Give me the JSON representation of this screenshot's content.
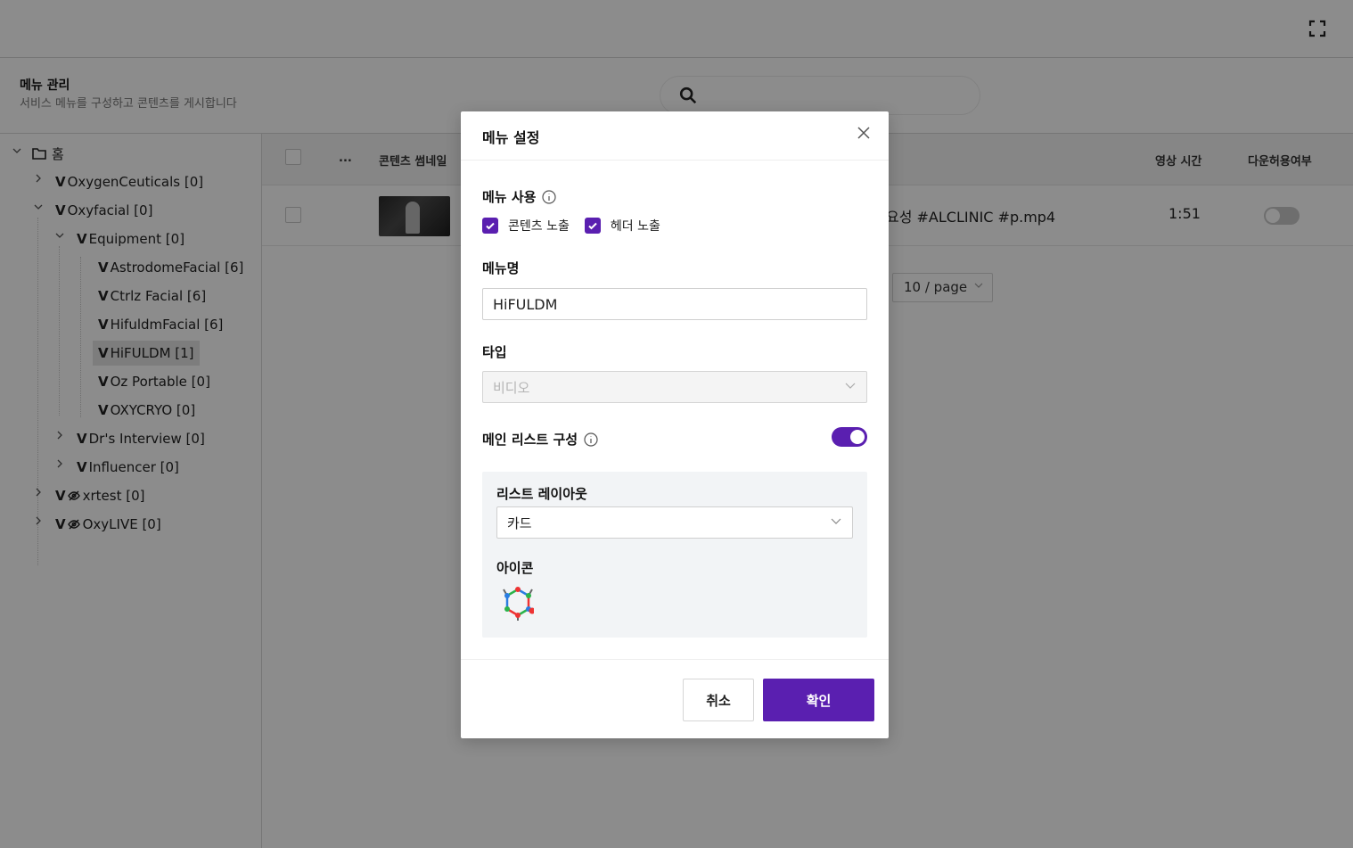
{
  "header": {
    "fullscreen_icon": "expand-icon"
  },
  "page": {
    "title": "메뉴 관리",
    "description": "서비스 메뉴를 구성하고 콘텐츠를 게시합니다",
    "search": {
      "value": "",
      "placeholder": ""
    }
  },
  "tree": {
    "root": "홈",
    "items": [
      {
        "label": "OxygenCeuticals [0]",
        "expanded": false
      },
      {
        "label": "Oxyfacial [0]",
        "expanded": true
      },
      {
        "label": "Equipment [0]",
        "expanded": true
      },
      {
        "label": "AstrodomeFacial [6]"
      },
      {
        "label": "Ctrlz Facial [6]"
      },
      {
        "label": "HifuldmFacial [6]"
      },
      {
        "label": "HiFULDM [1]",
        "selected": true
      },
      {
        "label": "Oz Portable [0]"
      },
      {
        "label": "OXYCRYO [0]"
      },
      {
        "label": "Dr's Interview [0]",
        "expanded": false
      },
      {
        "label": "Influencer [0]",
        "expanded": false
      },
      {
        "label": "xrtest [0]",
        "expanded": false,
        "hidden": true
      },
      {
        "label": "OxyLIVE [0]",
        "expanded": false,
        "hidden": true
      }
    ],
    "v_mark": "V"
  },
  "table": {
    "columns": {
      "more": "...",
      "thumbnail": "콘텐츠 썸네일",
      "duration": "영상 시간",
      "download": "다운허용여부"
    },
    "rows": [
      {
        "title": "요성 #ALCLINIC #p.mp4",
        "duration": "1:51",
        "download_allowed": false
      }
    ],
    "page_size": "10 / page"
  },
  "modal": {
    "title": "메뉴 설정",
    "menu_use": {
      "label": "메뉴 사용",
      "options": [
        {
          "label": "콘텐츠 노출",
          "checked": true
        },
        {
          "label": "헤더 노출",
          "checked": true
        }
      ]
    },
    "menu_name": {
      "label": "메뉴명",
      "value": "HiFULDM"
    },
    "type": {
      "label": "타입",
      "value": "비디오",
      "disabled": true
    },
    "main_list": {
      "label": "메인 리스트 구성",
      "enabled": true
    },
    "list_layout": {
      "label": "리스트 레이아웃",
      "value": "카드"
    },
    "icon": {
      "label": "아이콘",
      "name": "molecule-icon"
    },
    "cancel": "취소",
    "confirm": "확인"
  },
  "colors": {
    "accent": "#5a1fb0",
    "overlay": "rgba(0,0,0,0.45)"
  }
}
